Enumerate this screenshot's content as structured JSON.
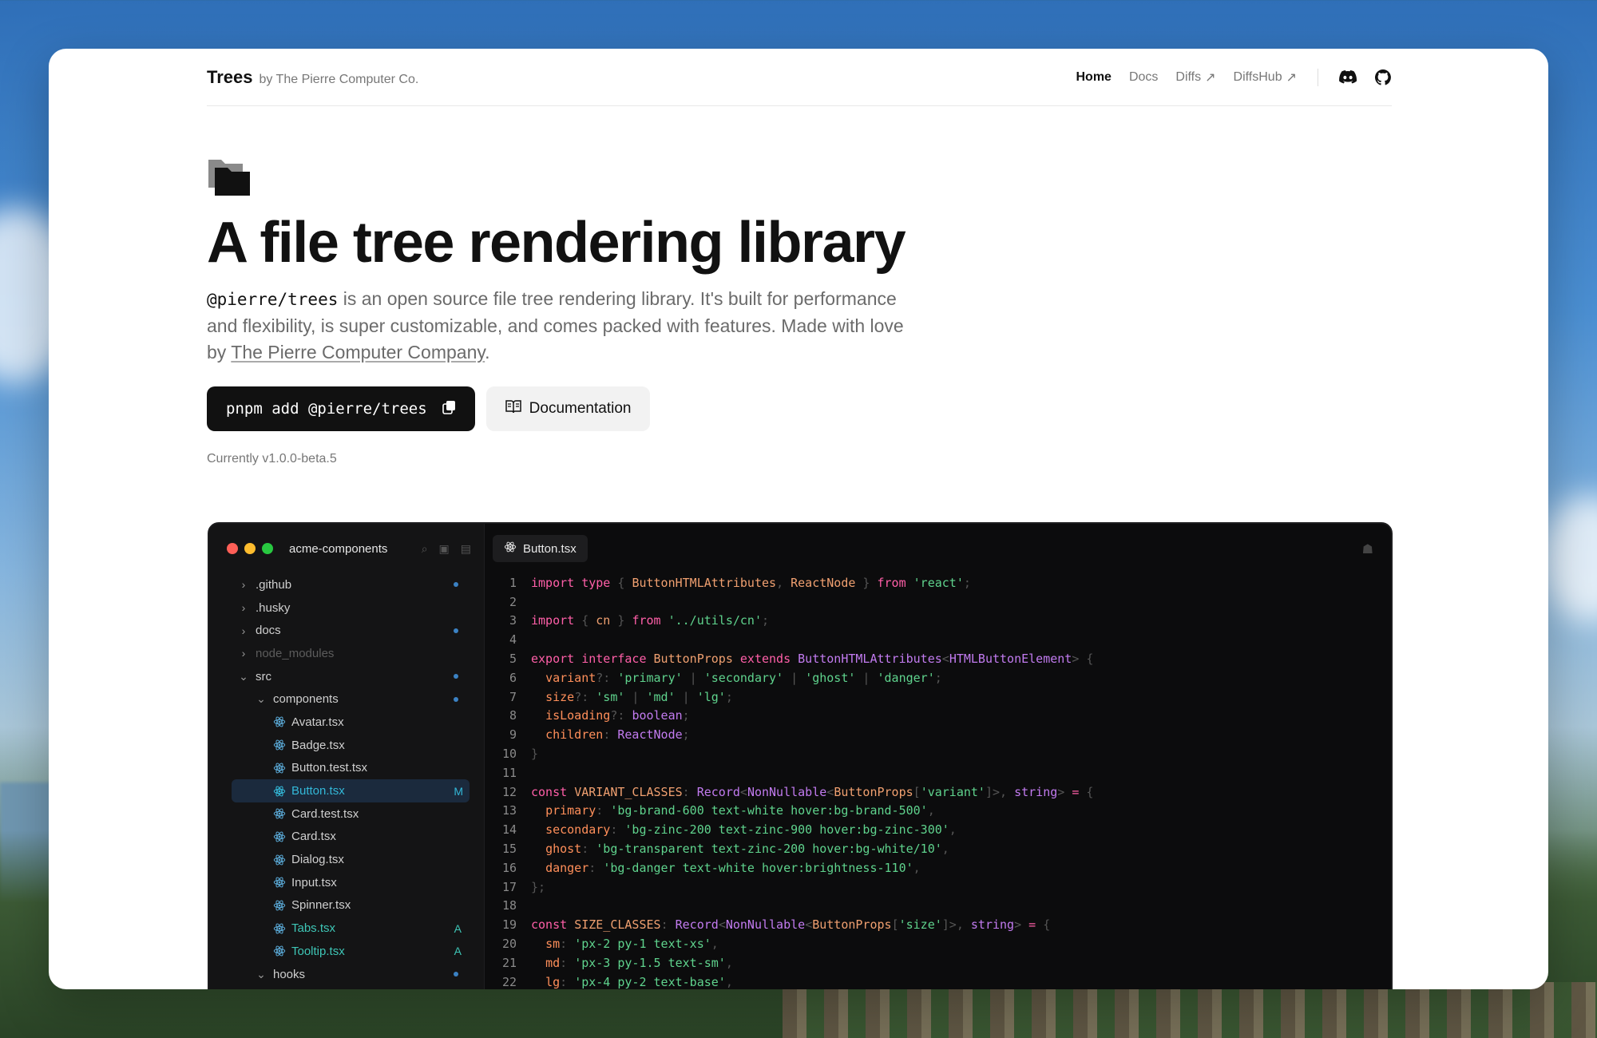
{
  "header": {
    "brand": "Trees",
    "by": "by The Pierre Computer Co.",
    "nav": [
      {
        "label": "Home",
        "active": true,
        "external": false
      },
      {
        "label": "Docs",
        "active": false,
        "external": false
      },
      {
        "label": "Diffs",
        "active": false,
        "external": true
      },
      {
        "label": "DiffsHub",
        "active": false,
        "external": true
      }
    ]
  },
  "hero": {
    "title": "A file tree rendering library",
    "desc_code": "@pierre/trees",
    "desc_part1": " is an open source file tree rendering library. It's built for performance and flexibility, is super customizable, and comes packed with features. Made with love by ",
    "desc_link": "The Pierre Computer Company",
    "desc_end": ".",
    "install_cmd": "pnpm add @pierre/trees",
    "docs_label": "Documentation",
    "version": "Currently v1.0.0-beta.5"
  },
  "editor": {
    "repo": "acme-components",
    "tab": "Button.tsx",
    "tree": [
      {
        "label": ".github",
        "level": 0,
        "type": "folder",
        "open": false,
        "dot": true
      },
      {
        "label": ".husky",
        "level": 0,
        "type": "folder",
        "open": false,
        "dot": false
      },
      {
        "label": "docs",
        "level": 0,
        "type": "folder",
        "open": false,
        "dot": true
      },
      {
        "label": "node_modules",
        "level": 0,
        "type": "folder",
        "open": false,
        "dot": false,
        "dim": true
      },
      {
        "label": "src",
        "level": 0,
        "type": "folder",
        "open": true,
        "dot": true
      },
      {
        "label": "components",
        "level": 1,
        "type": "folder",
        "open": true,
        "dot": true
      },
      {
        "label": "Avatar.tsx",
        "level": 2,
        "type": "file"
      },
      {
        "label": "Badge.tsx",
        "level": 2,
        "type": "file"
      },
      {
        "label": "Button.test.tsx",
        "level": 2,
        "type": "file"
      },
      {
        "label": "Button.tsx",
        "level": 2,
        "type": "file",
        "selected": true,
        "status": "M"
      },
      {
        "label": "Card.test.tsx",
        "level": 2,
        "type": "file"
      },
      {
        "label": "Card.tsx",
        "level": 2,
        "type": "file"
      },
      {
        "label": "Dialog.tsx",
        "level": 2,
        "type": "file"
      },
      {
        "label": "Input.tsx",
        "level": 2,
        "type": "file"
      },
      {
        "label": "Spinner.tsx",
        "level": 2,
        "type": "file"
      },
      {
        "label": "Tabs.tsx",
        "level": 2,
        "type": "file",
        "status": "A"
      },
      {
        "label": "Tooltip.tsx",
        "level": 2,
        "type": "file",
        "status": "A"
      },
      {
        "label": "hooks",
        "level": 1,
        "type": "folder",
        "open": true,
        "dot": true
      }
    ],
    "code": [
      [
        [
          "k",
          "import type "
        ],
        [
          "p",
          "{ "
        ],
        [
          "c",
          "ButtonHTMLAttributes"
        ],
        [
          "p",
          ", "
        ],
        [
          "c",
          "ReactNode"
        ],
        [
          "p",
          " } "
        ],
        [
          "k",
          "from "
        ],
        [
          "s",
          "'react'"
        ],
        [
          "p",
          ";"
        ]
      ],
      [],
      [
        [
          "k",
          "import "
        ],
        [
          "p",
          "{ "
        ],
        [
          "c",
          "cn"
        ],
        [
          "p",
          " } "
        ],
        [
          "k",
          "from "
        ],
        [
          "s",
          "'../utils/cn'"
        ],
        [
          "p",
          ";"
        ]
      ],
      [],
      [
        [
          "k",
          "export interface "
        ],
        [
          "c",
          "ButtonProps "
        ],
        [
          "k",
          "extends "
        ],
        [
          "t",
          "ButtonHTMLAttributes"
        ],
        [
          "p",
          "<"
        ],
        [
          "t",
          "HTMLButtonElement"
        ],
        [
          "p",
          "> {"
        ]
      ],
      [
        [
          "w",
          "  "
        ],
        [
          "v",
          "variant"
        ],
        [
          "p",
          "?: "
        ],
        [
          "s",
          "'primary'"
        ],
        [
          "p",
          " | "
        ],
        [
          "s",
          "'secondary'"
        ],
        [
          "p",
          " | "
        ],
        [
          "s",
          "'ghost'"
        ],
        [
          "p",
          " | "
        ],
        [
          "s",
          "'danger'"
        ],
        [
          "p",
          ";"
        ]
      ],
      [
        [
          "w",
          "  "
        ],
        [
          "v",
          "size"
        ],
        [
          "p",
          "?: "
        ],
        [
          "s",
          "'sm'"
        ],
        [
          "p",
          " | "
        ],
        [
          "s",
          "'md'"
        ],
        [
          "p",
          " | "
        ],
        [
          "s",
          "'lg'"
        ],
        [
          "p",
          ";"
        ]
      ],
      [
        [
          "w",
          "  "
        ],
        [
          "v",
          "isLoading"
        ],
        [
          "p",
          "?: "
        ],
        [
          "t",
          "boolean"
        ],
        [
          "p",
          ";"
        ]
      ],
      [
        [
          "w",
          "  "
        ],
        [
          "v",
          "children"
        ],
        [
          "p",
          ": "
        ],
        [
          "t",
          "ReactNode"
        ],
        [
          "p",
          ";"
        ]
      ],
      [
        [
          "p",
          "}"
        ]
      ],
      [],
      [
        [
          "k",
          "const "
        ],
        [
          "c",
          "VARIANT_CLASSES"
        ],
        [
          "p",
          ": "
        ],
        [
          "t",
          "Record"
        ],
        [
          "p",
          "<"
        ],
        [
          "t",
          "NonNullable"
        ],
        [
          "p",
          "<"
        ],
        [
          "c",
          "ButtonProps"
        ],
        [
          "p",
          "["
        ],
        [
          "s",
          "'variant'"
        ],
        [
          "p",
          "]>, "
        ],
        [
          "t",
          "string"
        ],
        [
          "p",
          "> "
        ],
        [
          "k",
          "= "
        ],
        [
          "p",
          "{"
        ]
      ],
      [
        [
          "w",
          "  "
        ],
        [
          "v",
          "primary"
        ],
        [
          "p",
          ": "
        ],
        [
          "s",
          "'bg-brand-600 text-white hover:bg-brand-500'"
        ],
        [
          "p",
          ","
        ]
      ],
      [
        [
          "w",
          "  "
        ],
        [
          "v",
          "secondary"
        ],
        [
          "p",
          ": "
        ],
        [
          "s",
          "'bg-zinc-200 text-zinc-900 hover:bg-zinc-300'"
        ],
        [
          "p",
          ","
        ]
      ],
      [
        [
          "w",
          "  "
        ],
        [
          "v",
          "ghost"
        ],
        [
          "p",
          ": "
        ],
        [
          "s",
          "'bg-transparent text-zinc-200 hover:bg-white/10'"
        ],
        [
          "p",
          ","
        ]
      ],
      [
        [
          "w",
          "  "
        ],
        [
          "v",
          "danger"
        ],
        [
          "p",
          ": "
        ],
        [
          "s",
          "'bg-danger text-white hover:brightness-110'"
        ],
        [
          "p",
          ","
        ]
      ],
      [
        [
          "p",
          "};"
        ]
      ],
      [],
      [
        [
          "k",
          "const "
        ],
        [
          "c",
          "SIZE_CLASSES"
        ],
        [
          "p",
          ": "
        ],
        [
          "t",
          "Record"
        ],
        [
          "p",
          "<"
        ],
        [
          "t",
          "NonNullable"
        ],
        [
          "p",
          "<"
        ],
        [
          "c",
          "ButtonProps"
        ],
        [
          "p",
          "["
        ],
        [
          "s",
          "'size'"
        ],
        [
          "p",
          "]>, "
        ],
        [
          "t",
          "string"
        ],
        [
          "p",
          "> "
        ],
        [
          "k",
          "= "
        ],
        [
          "p",
          "{"
        ]
      ],
      [
        [
          "w",
          "  "
        ],
        [
          "v",
          "sm"
        ],
        [
          "p",
          ": "
        ],
        [
          "s",
          "'px-2 py-1 text-xs'"
        ],
        [
          "p",
          ","
        ]
      ],
      [
        [
          "w",
          "  "
        ],
        [
          "v",
          "md"
        ],
        [
          "p",
          ": "
        ],
        [
          "s",
          "'px-3 py-1.5 text-sm'"
        ],
        [
          "p",
          ","
        ]
      ],
      [
        [
          "w",
          "  "
        ],
        [
          "v",
          "lg"
        ],
        [
          "p",
          ": "
        ],
        [
          "s",
          "'px-4 py-2 text-base'"
        ],
        [
          "p",
          ","
        ]
      ]
    ]
  },
  "colors": {
    "accent": "#111111",
    "selected_file": "#33b8d8",
    "added_file": "#3ec6b6",
    "status_dot": "#3b82c4"
  }
}
